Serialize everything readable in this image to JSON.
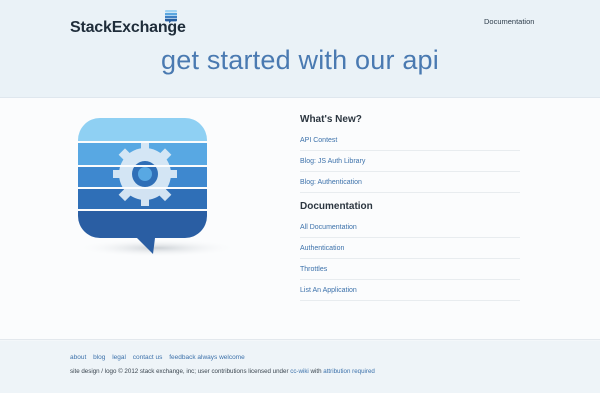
{
  "header": {
    "logo_text_part1": "Stack",
    "logo_text_part2": "Exchange",
    "nav_link": "Documentation",
    "hero_title": "get started with our api"
  },
  "whats_new": {
    "title": "What's New?",
    "items": [
      "API Contest",
      "Blog: JS Auth Library",
      "Blog: Authentication"
    ]
  },
  "documentation": {
    "title": "Documentation",
    "items": [
      "All Documentation",
      "Authentication",
      "Throttles",
      "List An Application"
    ]
  },
  "footer": {
    "links": [
      "about",
      "blog",
      "legal",
      "contact us",
      "feedback always welcome"
    ],
    "copyright_prefix": "site design / logo © 2012 stack exchange, inc; user contributions licensed under ",
    "license_link": "cc-wiki",
    "copyright_mid": " with ",
    "attribution_link": "attribution required"
  },
  "colors": {
    "accent": "#4a7ab1",
    "link": "#3d72ab",
    "header_bg": "#eaf2f7"
  },
  "icons": [
    "stackexchange-logo-icon",
    "api-gear-bubble-icon"
  ]
}
